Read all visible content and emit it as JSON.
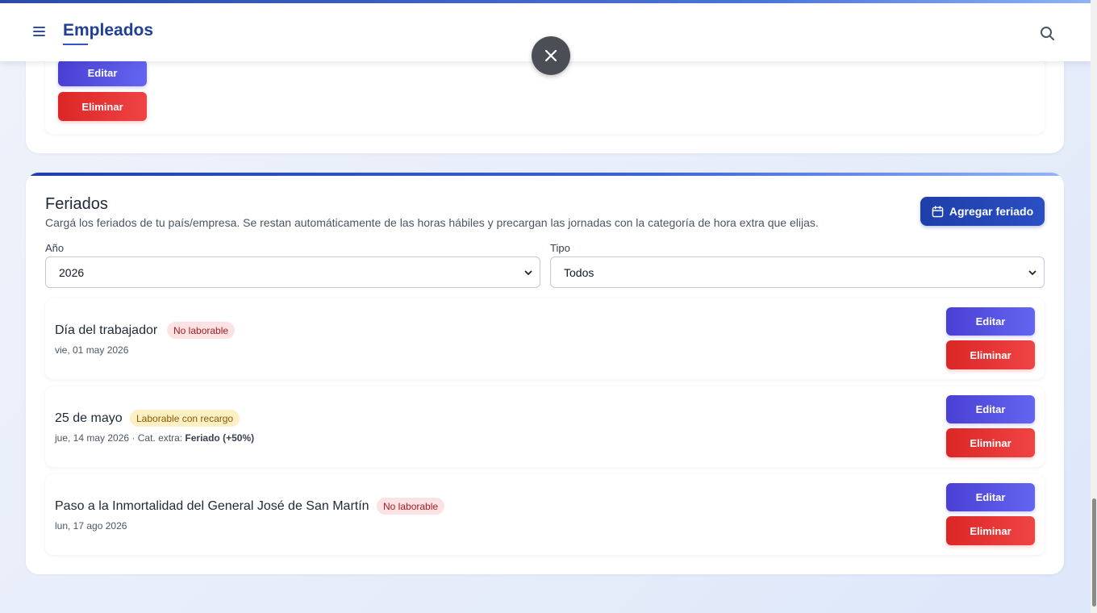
{
  "header": {
    "title": "Empleados",
    "menu_icon": "hamburger-menu-icon",
    "search_icon": "search-icon"
  },
  "overlay": {
    "close_icon": "close-icon"
  },
  "top_card": {
    "edit_label": "Editar",
    "delete_label": "Eliminar"
  },
  "holidays_section": {
    "title": "Feriados",
    "description": "Cargá los feriados de tu país/empresa. Se restan automáticamente de las horas hábiles y precargan las jornadas con la categoría de hora extra que elijas.",
    "add_button_label": "Agregar feriado",
    "add_button_icon": "calendar-icon",
    "filters": {
      "year_label": "Año",
      "year_value": "2026",
      "type_label": "Tipo",
      "type_value": "Todos"
    },
    "items": [
      {
        "name": "Día del trabajador",
        "badge": "No laborable",
        "badge_kind": "red",
        "date": "vie, 01 may 2026",
        "extra_prefix": "",
        "extra_value": "",
        "edit_label": "Editar",
        "delete_label": "Eliminar"
      },
      {
        "name": "25 de mayo",
        "badge": "Laborable con recargo",
        "badge_kind": "yellow",
        "date": "jue, 14 may 2026",
        "extra_prefix": " · Cat. extra: ",
        "extra_value": "Feriado (+50%)",
        "edit_label": "Editar",
        "delete_label": "Eliminar"
      },
      {
        "name": "Paso a la Inmortalidad del General José de San Martín",
        "badge": "No laborable",
        "badge_kind": "red",
        "date": "lun, 17 ago 2026",
        "extra_prefix": "",
        "extra_value": "",
        "edit_label": "Editar",
        "delete_label": "Eliminar"
      }
    ]
  },
  "colors": {
    "brand": "#213f95",
    "edit": "#4f46e5",
    "delete": "#dc2626",
    "badge_red_bg": "#fde2e4",
    "badge_yellow_bg": "#fdf0c4"
  }
}
